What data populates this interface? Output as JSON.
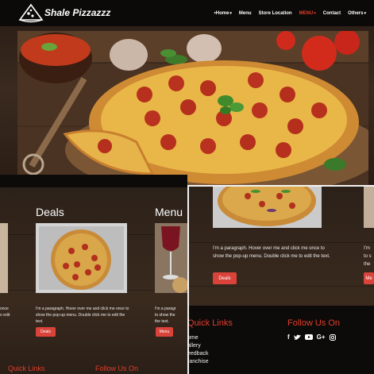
{
  "header": {
    "brand": "Shale Pizzazzz",
    "nav": [
      {
        "label": "Home",
        "caret": "▾",
        "prefix": "•"
      },
      {
        "label": "Menu"
      },
      {
        "label": "Store Location"
      },
      {
        "label": "MENU",
        "caret": "▾",
        "active": true
      },
      {
        "label": "Contact"
      },
      {
        "label": "Others",
        "caret": "▾"
      }
    ]
  },
  "sections": {
    "deals": {
      "title": "Deals",
      "description": "I'm a paragraph. Hover over me and click me once to show the pop-up menu. Double click me to edit the text.",
      "button": "Deals"
    },
    "menu": {
      "title": "Menu",
      "description_lines": [
        "I'm a paragr",
        "to show the",
        "the text."
      ],
      "button": "Menu"
    },
    "left_edge": {
      "description_lines": [
        "once",
        "o edit"
      ]
    }
  },
  "right": {
    "description": "I'm a paragraph. Hover over me and click me once to show the pop-up menu. Double click me to edit the text.",
    "button": "Deals",
    "edge_description_lines": [
      "I'm",
      "to s",
      "the"
    ],
    "edge_button": "Me"
  },
  "footer": {
    "quick_links_title": "Quick Links",
    "follow_title": "Follow Us On",
    "links": [
      "ome",
      "allery",
      "eedback",
      "ranchise"
    ],
    "social": [
      "f",
      "t",
      "▶",
      "G+",
      "◎"
    ]
  },
  "colors": {
    "accent": "#e23d2b",
    "button": "#d9433a",
    "bar": "#0b0a09"
  }
}
